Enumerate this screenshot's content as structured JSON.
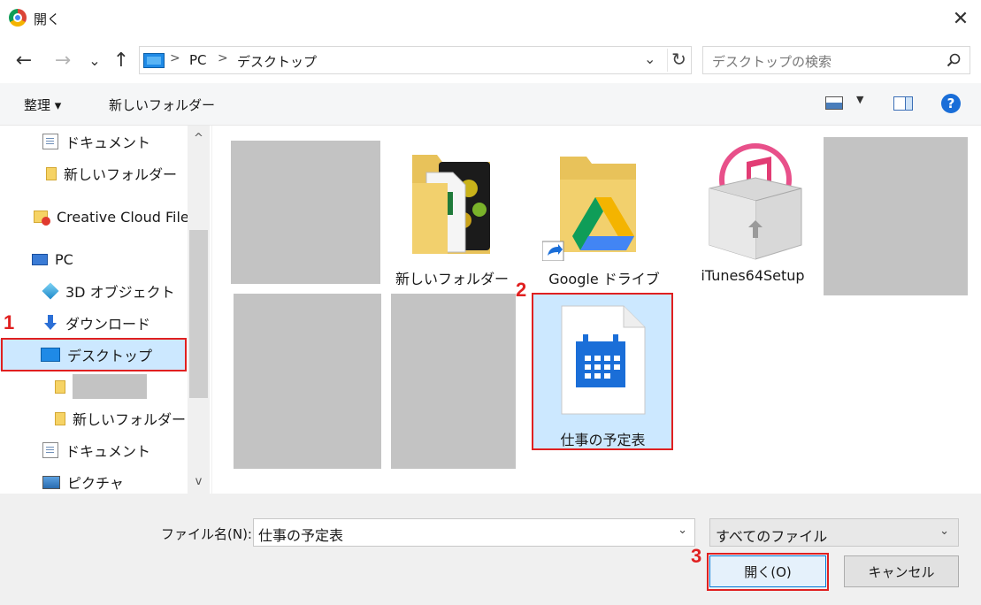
{
  "window": {
    "title": "開く",
    "close": "✕"
  },
  "nav": {
    "back": "←",
    "forward": "→",
    "recent": "⌄",
    "up": "↑"
  },
  "address": {
    "crumbs": [
      "PC",
      "デスクトップ"
    ],
    "sep": ">",
    "dropdown": "⌄",
    "refresh": "↻"
  },
  "search": {
    "placeholder": "デスクトップの検索"
  },
  "toolbar": {
    "organize": "整理 ▾",
    "new_folder": "新しいフォルダー",
    "view_dd": "▼",
    "help": "?"
  },
  "sidebar": {
    "items": [
      {
        "label": "ドキュメント"
      },
      {
        "label": "新しいフォルダー"
      },
      {
        "label": "Creative Cloud Files"
      },
      {
        "label": "PC"
      },
      {
        "label": "3D オブジェクト"
      },
      {
        "label": "ダウンロード"
      },
      {
        "label": "デスクトップ"
      },
      {
        "label": ""
      },
      {
        "label": "新しいフォルダー"
      },
      {
        "label": "ドキュメント"
      },
      {
        "label": "ピクチャ"
      }
    ],
    "scroll_up": "^",
    "scroll_down": "v"
  },
  "files": [
    {
      "label": "新しいフォルダー"
    },
    {
      "label": "Google ドライブ"
    },
    {
      "label": "iTunes64Setup"
    },
    {
      "label": "仕事の予定表"
    }
  ],
  "footer": {
    "filename_label": "ファイル名(N):",
    "filename_value": "仕事の予定表",
    "filter": "すべてのファイル",
    "dd": "⌄",
    "open": "開く(O)",
    "cancel": "キャンセル"
  },
  "annotations": {
    "n1": "1",
    "n2": "2",
    "n3": "3"
  },
  "colors": {
    "highlight": "#e02020",
    "selection": "#cce8ff",
    "accent": "#0078d7"
  }
}
